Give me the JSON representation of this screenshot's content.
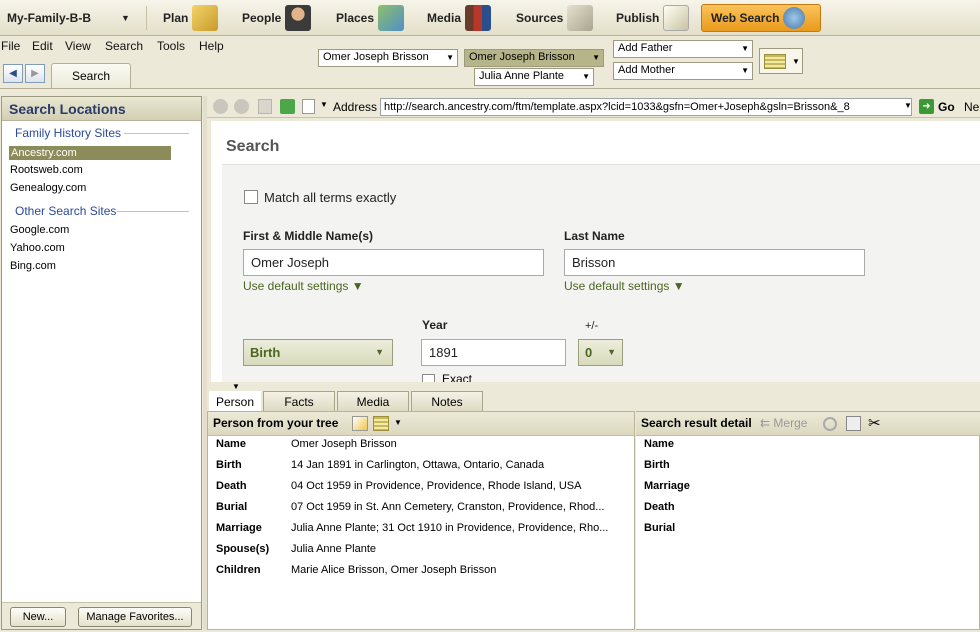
{
  "toolbar": {
    "tree_name": "My-Family-B-B",
    "items": [
      "Plan",
      "People",
      "Places",
      "Media",
      "Sources",
      "Publish"
    ],
    "web_search": "Web Search"
  },
  "menu": [
    "File",
    "Edit",
    "View",
    "Search",
    "Tools",
    "Help"
  ],
  "person_bar": {
    "father": "Omer Joseph Brisson",
    "current": "Omer Joseph Brisson",
    "spouse": "Julia Anne Plante",
    "add_father": "Add Father",
    "add_mother": "Add Mother"
  },
  "nav": {
    "back": "◀",
    "forward": "▶",
    "tab": "Search"
  },
  "left_panel": {
    "title": "Search Locations",
    "group1": "Family History Sites",
    "family_sites": [
      "Ancestry.com",
      "Rootsweb.com",
      "Genealogy.com"
    ],
    "group2": "Other Search Sites",
    "other_sites": [
      "Google.com",
      "Yahoo.com",
      "Bing.com"
    ],
    "new_btn": "New...",
    "manage_btn": "Manage Favorites..."
  },
  "browser": {
    "address_label": "Address",
    "url": "http://search.ancestry.com/ftm/template.aspx?lcid=1033&gsfn=Omer+Joseph&gsln=Brisson&_8",
    "go": "Go",
    "next": "Ne"
  },
  "web": {
    "title": "Search",
    "match_exact": "Match all terms exactly",
    "first_label": "First & Middle Name(s)",
    "first_value": "Omer Joseph",
    "last_label": "Last Name",
    "last_value": "Brisson",
    "use_default": "Use default settings ▼",
    "event": "Birth",
    "year_label": "Year",
    "year_value": "1891",
    "pm_label": "+/-",
    "pm_value": "0",
    "exact": "Exact"
  },
  "tabs": [
    "Person",
    "Facts",
    "Media",
    "Notes"
  ],
  "person_panel": {
    "header": "Person from your tree",
    "rows": [
      {
        "key": "Name",
        "value": "Omer Joseph Brisson"
      },
      {
        "key": "Birth",
        "value": "14 Jan 1891 in Carlington, Ottawa, Ontario, Canada"
      },
      {
        "key": "Death",
        "value": "04 Oct 1959 in Providence, Providence, Rhode Island, USA"
      },
      {
        "key": "Burial",
        "value": "07 Oct 1959 in St. Ann Cemetery, Cranston, Providence, Rhod..."
      },
      {
        "key": "Marriage",
        "value": "Julia Anne Plante; 31 Oct 1910 in Providence, Providence, Rho..."
      },
      {
        "key": "Spouse(s)",
        "value": "Julia Anne Plante"
      },
      {
        "key": "Children",
        "value": "Marie Alice Brisson, Omer Joseph Brisson"
      }
    ]
  },
  "result_panel": {
    "header": "Search result detail",
    "merge": "Merge",
    "rows": [
      "Name",
      "Birth",
      "Marriage",
      "Death",
      "Burial"
    ]
  }
}
